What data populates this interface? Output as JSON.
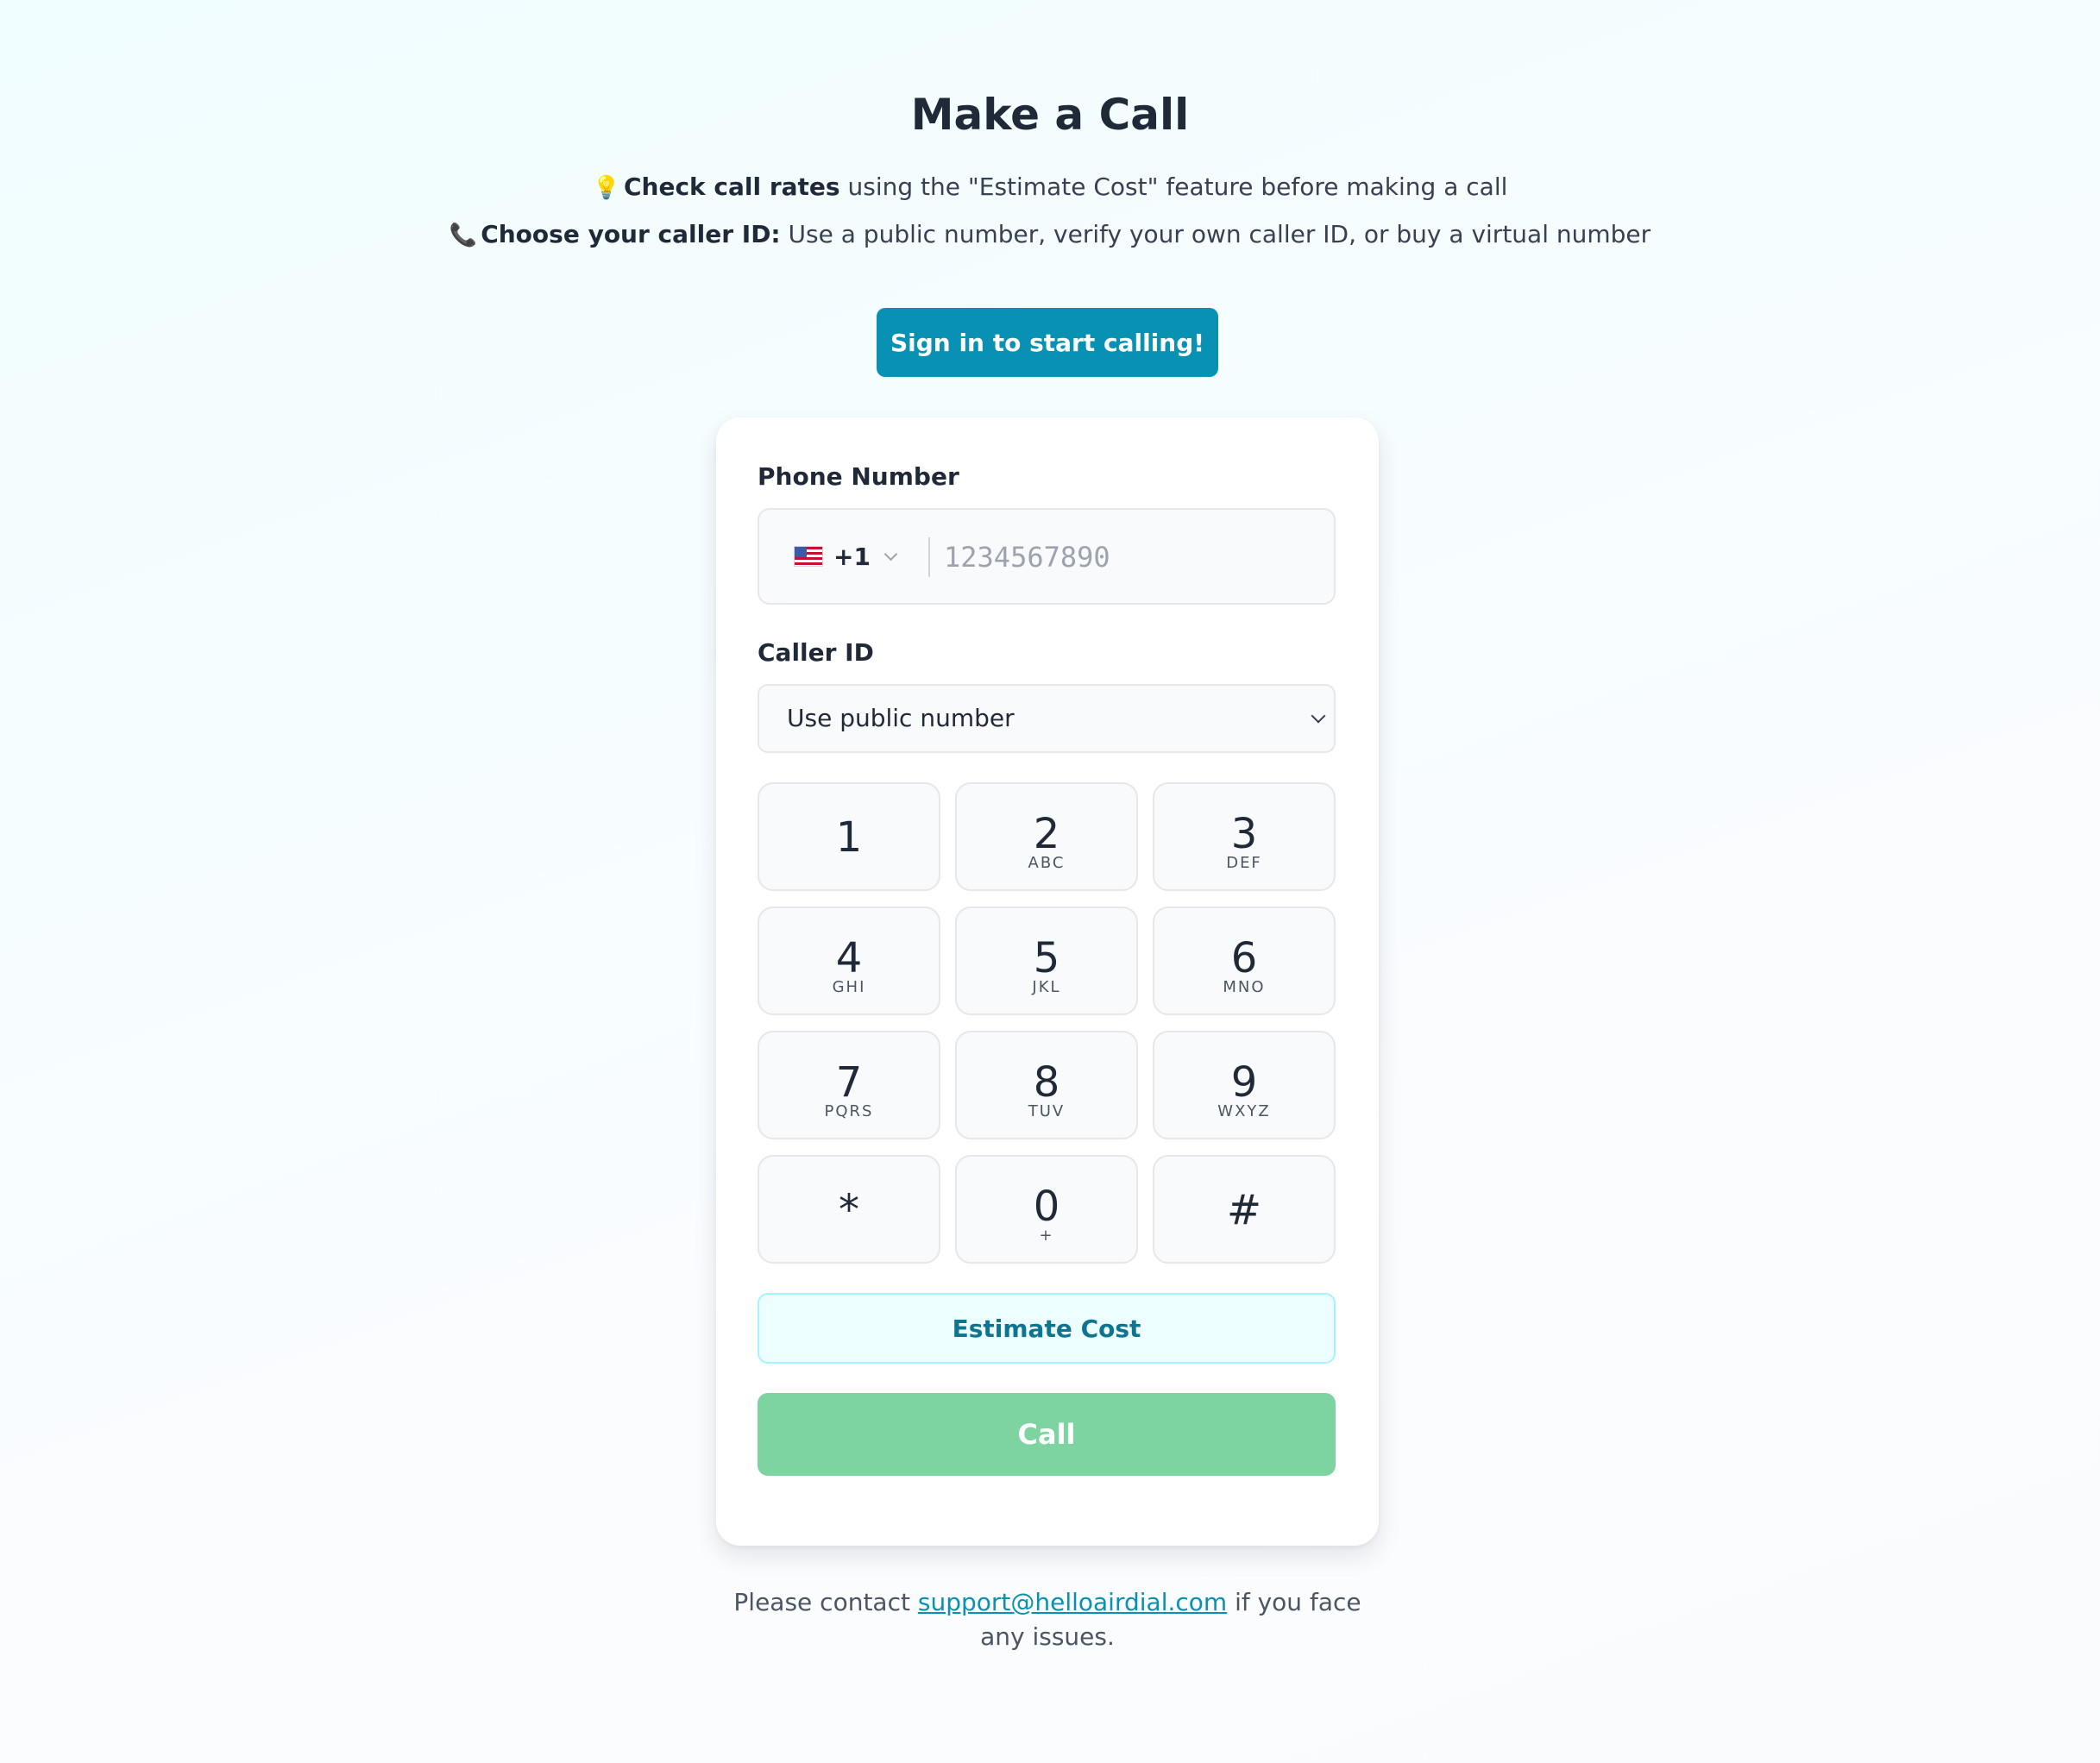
{
  "page": {
    "title": "Make a Call"
  },
  "tips": [
    {
      "icon": "lightbulb-icon",
      "glyph": "💡",
      "bold": "Check call rates",
      "text": " using the \"Estimate Cost\" feature before making a call"
    },
    {
      "icon": "phone-icon",
      "glyph": "📞",
      "bold": "Choose your caller ID:",
      "text": " Use a public number, verify your own caller ID, or buy a virtual number"
    }
  ],
  "signin_button": "Sign in to start calling!",
  "phone": {
    "label": "Phone Number",
    "country_code": "+1",
    "country_flag": "us-flag-icon",
    "placeholder": "1234567890",
    "value": ""
  },
  "caller_id": {
    "label": "Caller ID",
    "selected": "Use public number"
  },
  "keypad": [
    {
      "digit": "1",
      "letters": ""
    },
    {
      "digit": "2",
      "letters": "ABC"
    },
    {
      "digit": "3",
      "letters": "DEF"
    },
    {
      "digit": "4",
      "letters": "GHI"
    },
    {
      "digit": "5",
      "letters": "JKL"
    },
    {
      "digit": "6",
      "letters": "MNO"
    },
    {
      "digit": "7",
      "letters": "PQRS"
    },
    {
      "digit": "8",
      "letters": "TUV"
    },
    {
      "digit": "9",
      "letters": "WXYZ"
    },
    {
      "digit": "*",
      "letters": ""
    },
    {
      "digit": "0",
      "letters": "+"
    },
    {
      "digit": "#",
      "letters": ""
    }
  ],
  "estimate_button": "Estimate Cost",
  "call_button": "Call",
  "footer": {
    "before": "Please contact ",
    "email": "support@helloairdial.com",
    "after": " if you face any issues."
  },
  "colors": {
    "accent": "#0891b2",
    "call_button": "#7dd4a1",
    "estimate_bg": "#ecfeff"
  }
}
